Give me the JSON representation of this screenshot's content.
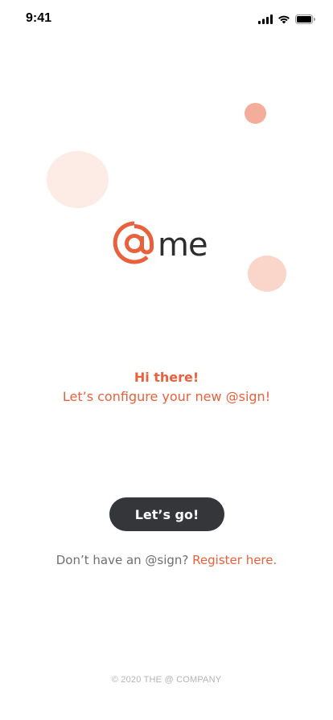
{
  "status_bar": {
    "time": "9:41",
    "icons": [
      "cellular-signal-icon",
      "wifi-icon",
      "battery-icon"
    ]
  },
  "logo": {
    "symbol": "@",
    "text": "me",
    "symbol_color": "#e9603c",
    "text_color": "#2d2d2d"
  },
  "greeting": {
    "title": "Hi there!",
    "subtitle": "Let’s configure your new @sign!"
  },
  "cta": {
    "label": "Let’s go!"
  },
  "register": {
    "prompt": "Don’t have an @sign?",
    "link_label": "Register here."
  },
  "footer": {
    "text": "© 2020 THE @ COMPANY"
  },
  "colors": {
    "accent": "#e9603c",
    "button_bg": "#34363a",
    "bubble_strong": "#f4ad9a",
    "bubble_light": "#fdebe5",
    "bubble_mid": "#fad5ca"
  }
}
